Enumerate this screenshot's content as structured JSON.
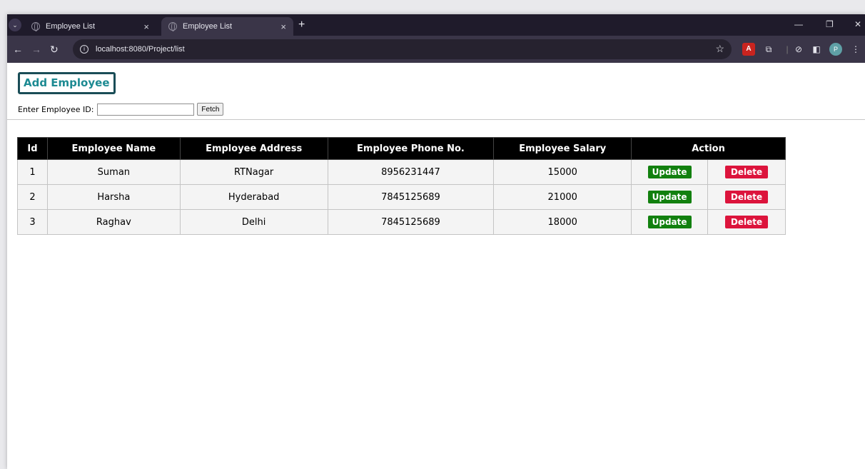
{
  "browser": {
    "tabs": [
      {
        "title": "Employee List",
        "close": "×"
      },
      {
        "title": "Employee List",
        "close": "×"
      }
    ],
    "new_tab": "+",
    "url": "localhost:8080/Project/list"
  },
  "page": {
    "add_button_label": "Add Employee",
    "fetch_label": "Enter Employee ID:",
    "fetch_input_value": "",
    "fetch_button_label": "Fetch"
  },
  "table": {
    "headers": [
      "Id",
      "Employee Name",
      "Employee Address",
      "Employee Phone No.",
      "Employee Salary",
      "Action"
    ],
    "rows": [
      {
        "id": "1",
        "name": "Suman",
        "address": "RTNagar",
        "phone": "8956231447",
        "salary": "15000",
        "update": "Update",
        "delete": "Delete"
      },
      {
        "id": "2",
        "name": "Harsha",
        "address": "Hyderabad",
        "phone": "7845125689",
        "salary": "21000",
        "update": "Update",
        "delete": "Delete"
      },
      {
        "id": "3",
        "name": "Raghav",
        "address": "Delhi",
        "phone": "7845125689",
        "salary": "18000",
        "update": "Update",
        "delete": "Delete"
      }
    ]
  },
  "colors": {
    "update": "#12800f",
    "delete": "#dc143c",
    "add_text": "#1c8a92",
    "add_border": "#1a4d57",
    "header_bg": "#000000"
  },
  "icons": [
    "tab-menu-icon",
    "globe-icon",
    "back-arrow-icon",
    "forward-arrow-icon",
    "reload-icon",
    "site-info-icon",
    "bookmark-star-icon",
    "pdf-extension-icon",
    "extensions-puzzle-icon",
    "sync-icon",
    "side-panel-icon",
    "profile-avatar-icon",
    "more-menu-icon",
    "minimize-icon",
    "maximize-icon",
    "close-window-icon"
  ]
}
